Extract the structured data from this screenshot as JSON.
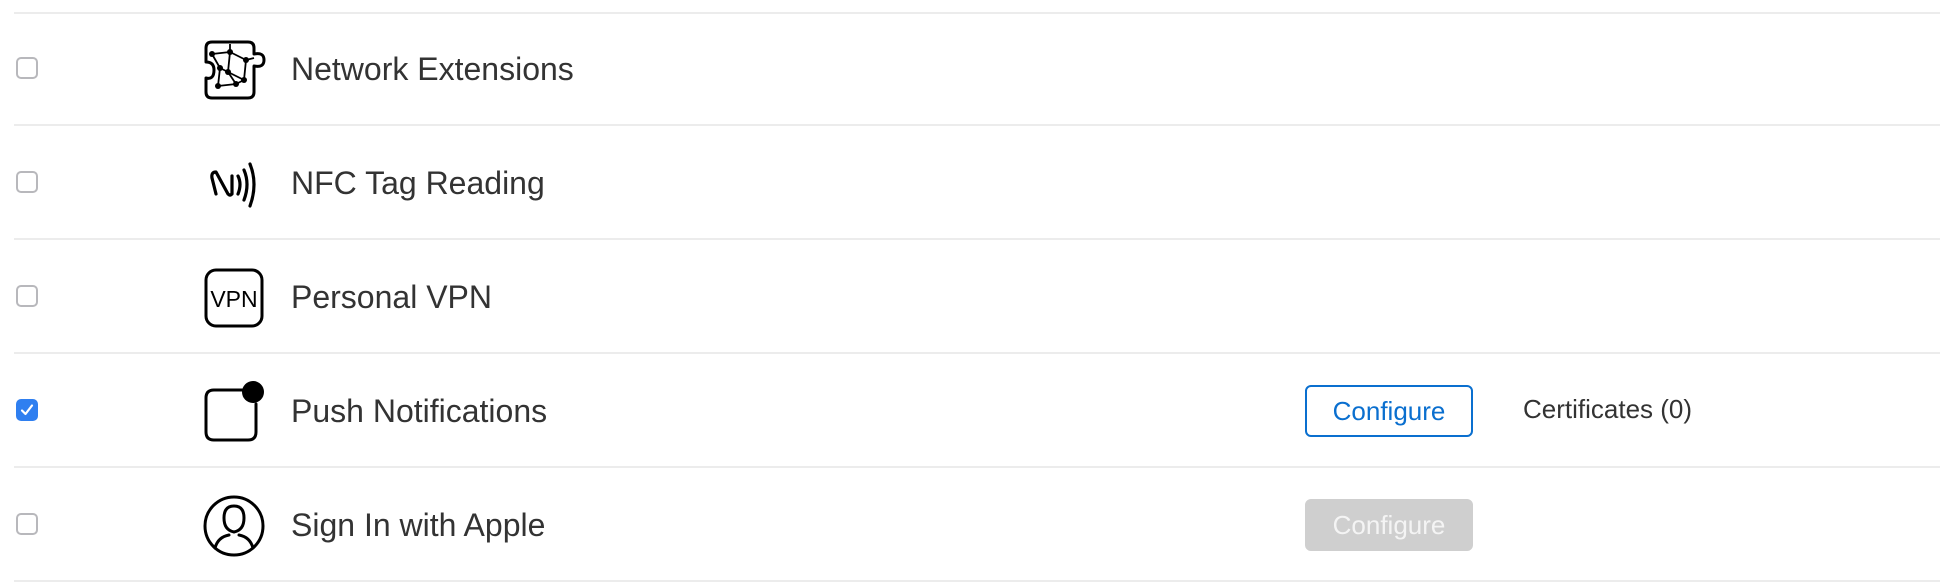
{
  "capabilities": [
    {
      "label": "Network Extensions",
      "checked": false,
      "icon": "network-extensions-icon"
    },
    {
      "label": "NFC Tag Reading",
      "checked": false,
      "icon": "nfc-icon"
    },
    {
      "label": "Personal VPN",
      "checked": true,
      "icon": "vpn-icon",
      "icon_text": "VPN"
    },
    {
      "label": "Push Notifications",
      "checked": true,
      "icon": "push-notification-icon",
      "configure_label": "Configure",
      "certificates_label": "Certificates (0)"
    },
    {
      "label": "Sign In with Apple",
      "checked": false,
      "icon": "person-icon",
      "configure_label": "Configure",
      "configure_enabled": false
    }
  ],
  "colors": {
    "accent": "#0a6fcf",
    "checkbox_checked": "#2f7ff0",
    "disabled_button": "#cfcfcf",
    "divider": "#ececec"
  }
}
